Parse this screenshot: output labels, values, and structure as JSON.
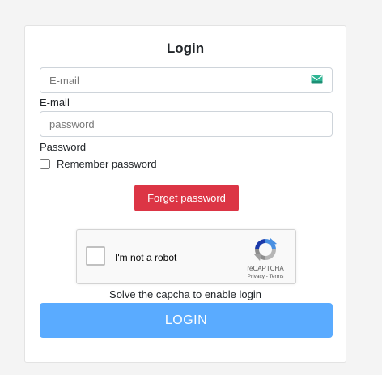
{
  "form": {
    "title": "Login",
    "email_placeholder": "E-mail",
    "email_value": "",
    "email_label": "E-mail",
    "password_placeholder": "password",
    "password_value": "",
    "password_label": "Password",
    "remember_label": "Remember password",
    "remember_checked": false,
    "forget_button": "Forget password",
    "captcha_note": "Solve the capcha to enable login",
    "login_button": "LOGIN"
  },
  "recaptcha": {
    "label": "I'm not a robot",
    "brand": "reCAPTCHA",
    "privacy": "Privacy",
    "separator": " - ",
    "terms": "Terms"
  },
  "icons": {
    "email_field_icon": "mail-icon",
    "recaptcha_logo": "recaptcha-logo-icon"
  },
  "colors": {
    "danger": "#dc3545",
    "primary_disabled": "#5aabff",
    "mail_icon": "#28a98b"
  }
}
